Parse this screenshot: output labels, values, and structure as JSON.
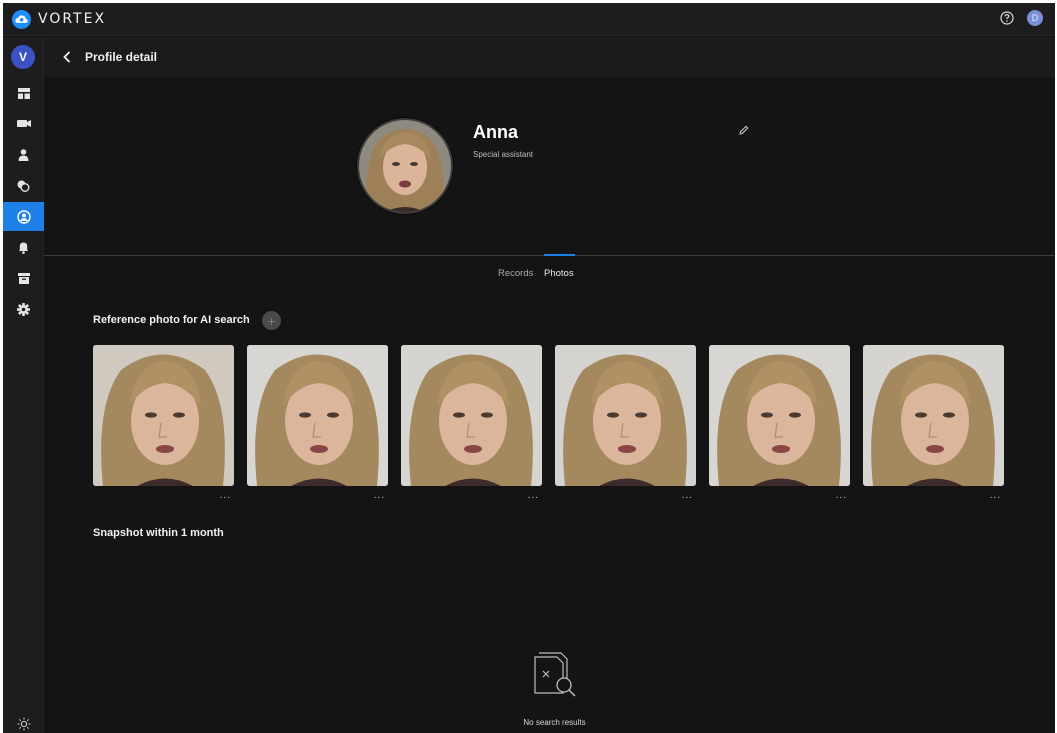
{
  "app": {
    "brand": "VORTEX",
    "user_initial": "D"
  },
  "sidebar": {
    "avatar_initial": "V",
    "items": [
      {
        "icon": "dashboard-icon"
      },
      {
        "icon": "camera-icon"
      },
      {
        "icon": "person-icon"
      },
      {
        "icon": "faces-icon"
      },
      {
        "icon": "profile-icon",
        "active": true
      },
      {
        "icon": "bell-icon"
      },
      {
        "icon": "archive-icon"
      },
      {
        "icon": "gear-icon"
      }
    ],
    "bottom_icon": "sun-icon"
  },
  "header": {
    "title": "Profile detail"
  },
  "profile": {
    "name": "Anna",
    "role": "Special assistant"
  },
  "tabs": [
    {
      "label": "Records"
    },
    {
      "label": "Photos",
      "active": true
    }
  ],
  "reference": {
    "title": "Reference photo for AI search",
    "add_label": "+",
    "photos": [
      {
        "more": "..."
      },
      {
        "more": "..."
      },
      {
        "more": "..."
      },
      {
        "more": "..."
      },
      {
        "more": "..."
      },
      {
        "more": "..."
      }
    ]
  },
  "snapshot": {
    "title": "Snapshot within 1 month",
    "empty_text": "No search results"
  },
  "colors": {
    "accent": "#1e7fe6",
    "background": "#141414",
    "panel": "#1d1d1f"
  }
}
